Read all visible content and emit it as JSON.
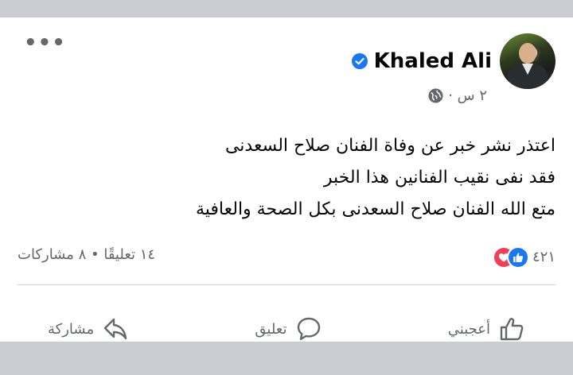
{
  "post": {
    "author": "Khaled Ali",
    "time": "٢ س ·",
    "lines": [
      "اعتذر نشر خبر عن وفاة الفنان صلاح السعدنى",
      "فقد نفى نقيب الفنانين هذا الخبر",
      "متع الله الفنان صلاح السعدنى بكل الصحة والعافية"
    ]
  },
  "stats": {
    "reactions_count": "٤٢١",
    "comments_shares": "١٤ تعليقًا • ٨ مشاركات"
  },
  "actions": {
    "like": "أعجبني",
    "comment": "تعليق",
    "share": "مشاركة"
  },
  "colors": {
    "verified": "#1877f2",
    "like": "#1877f2",
    "love": "#f33e58",
    "secondary_text": "#65676b"
  },
  "icons": {
    "more": "more-dots-icon",
    "verified": "verified-badge-icon",
    "privacy": "globe-icon",
    "like_action": "thumbs-up-icon",
    "comment_action": "speech-bubble-icon",
    "share_action": "share-arrow-icon"
  }
}
